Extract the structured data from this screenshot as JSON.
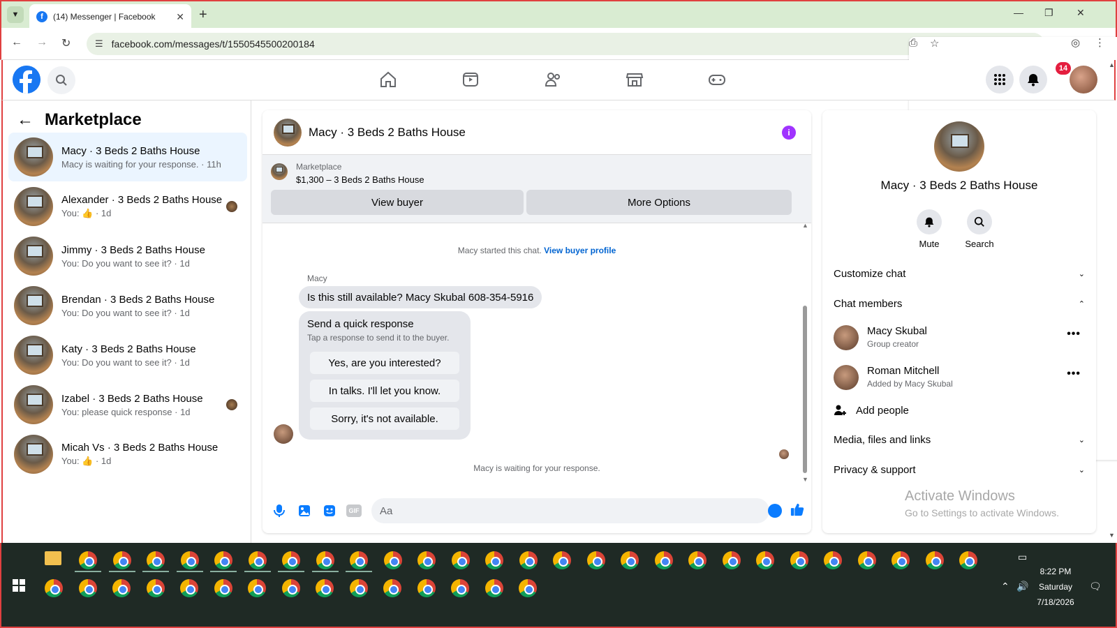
{
  "browser": {
    "tab_title": "(14) Messenger | Facebook",
    "tab_favicon": "f",
    "tab_close": "✕",
    "new_tab": "+",
    "minimize": "—",
    "restore": "❐",
    "close": "✕",
    "url": "facebook.com/messages/t/1550545500200184"
  },
  "header": {
    "notification_count": "14"
  },
  "left": {
    "title": "Marketplace",
    "conversations": [
      {
        "name": "Macy · 3 Beds 2 Baths House",
        "sub": "Macy is waiting for your response. · 11h",
        "active": true
      },
      {
        "name": "Alexander · 3 Beds 2 Baths House",
        "sub": "You: 👍 · 1d"
      },
      {
        "name": "Jimmy · 3 Beds 2 Baths House",
        "sub": "You: Do you want to see it? · 1d"
      },
      {
        "name": "Brendan · 3 Beds 2 Baths House",
        "sub": "You: Do you want to see it? · 1d"
      },
      {
        "name": "Katy · 3 Beds 2 Baths House",
        "sub": "You: Do you want to see it? · 1d"
      },
      {
        "name": "Izabel · 3 Beds 2 Baths House",
        "sub": "You: please quick response · 1d"
      },
      {
        "name": "Micah Vs · 3 Beds 2 Baths House",
        "sub": "You: 👍 · 1d"
      }
    ]
  },
  "chat": {
    "title": "Macy · 3 Beds 2 Baths House",
    "marketplace_label": "Marketplace",
    "listing": "$1,300 – 3 Beds 2 Baths House",
    "view_buyer": "View buyer",
    "more_options": "More Options",
    "started": "Macy started this chat.",
    "view_buyer_profile": "View buyer profile",
    "sender": "Macy",
    "message": "Is this still available? Macy Skubal 608-354-5916",
    "quick_title": "Send a quick response",
    "quick_sub": "Tap a response to send it to the buyer.",
    "quick_responses": [
      "Yes, are you interested?",
      "In talks. I'll let you know.",
      "Sorry, it's not available."
    ],
    "waiting": "Macy is waiting for your response.",
    "input_placeholder": "Aa",
    "gif_label": "GIF"
  },
  "panel": {
    "name": "Macy · 3 Beds 2 Baths House",
    "mute": "Mute",
    "search": "Search",
    "customize": "Customize chat",
    "members_title": "Chat members",
    "members": [
      {
        "name": "Macy Skubal",
        "role": "Group creator"
      },
      {
        "name": "Roman Mitchell",
        "role": "Added by Macy Skubal"
      }
    ],
    "add_people": "Add people",
    "media": "Media, files and links",
    "privacy": "Privacy & support",
    "dots": "•••",
    "chev_down": "⌄",
    "chev_up": "⌃"
  },
  "watermark": {
    "line1": "Activate Windows",
    "line2": "Go to Settings to activate Windows."
  },
  "taskbar": {
    "time": "8:22 PM",
    "day": "Saturday",
    "date": "7/18/2026"
  }
}
